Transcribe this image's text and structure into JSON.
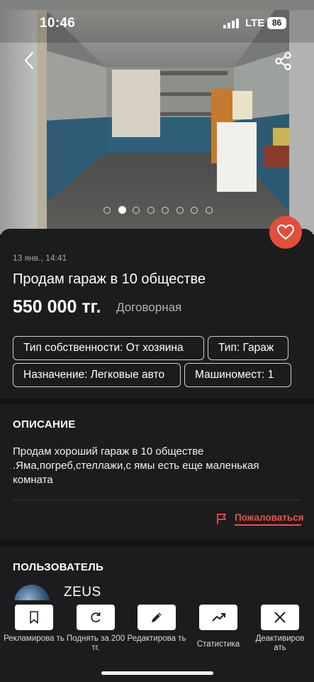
{
  "status_bar": {
    "time": "10:46",
    "network": "LTE",
    "battery": "86"
  },
  "gallery": {
    "photo_count": 8,
    "active_index": 1
  },
  "listing": {
    "date": "13 янв., 14:41",
    "title": "Продам гараж в 10 обществе",
    "price": "550 000 тг.",
    "negotiable": "Договорная"
  },
  "tags": [
    "Тип собственности: От хозяина",
    "Тип: Гараж",
    "Назначение: Легковые авто",
    "Машиномест: 1"
  ],
  "description": {
    "heading": "ОПИСАНИЕ",
    "text": "Продам хороший гараж в 10 обществе .Яма,погреб,стеллажи,с ямы есть еще маленькая комната"
  },
  "report": {
    "label": "Пожаловаться"
  },
  "user": {
    "heading": "ПОЛЬЗОВАТЕЛЬ",
    "name": "ZEUS"
  },
  "toolbar": [
    {
      "label": "Рекламирова ть",
      "icon": "flag-icon"
    },
    {
      "label": "Поднять за 200 тг.",
      "icon": "refresh-icon"
    },
    {
      "label": "Редактирова ть",
      "icon": "pencil-icon"
    },
    {
      "label": "Статистика",
      "icon": "trend-up-icon"
    },
    {
      "label": "Деактивиров ать",
      "icon": "close-icon"
    }
  ],
  "colors": {
    "accent": "#e04e3c",
    "background": "#1c1c1e",
    "report": "#e8543f"
  }
}
